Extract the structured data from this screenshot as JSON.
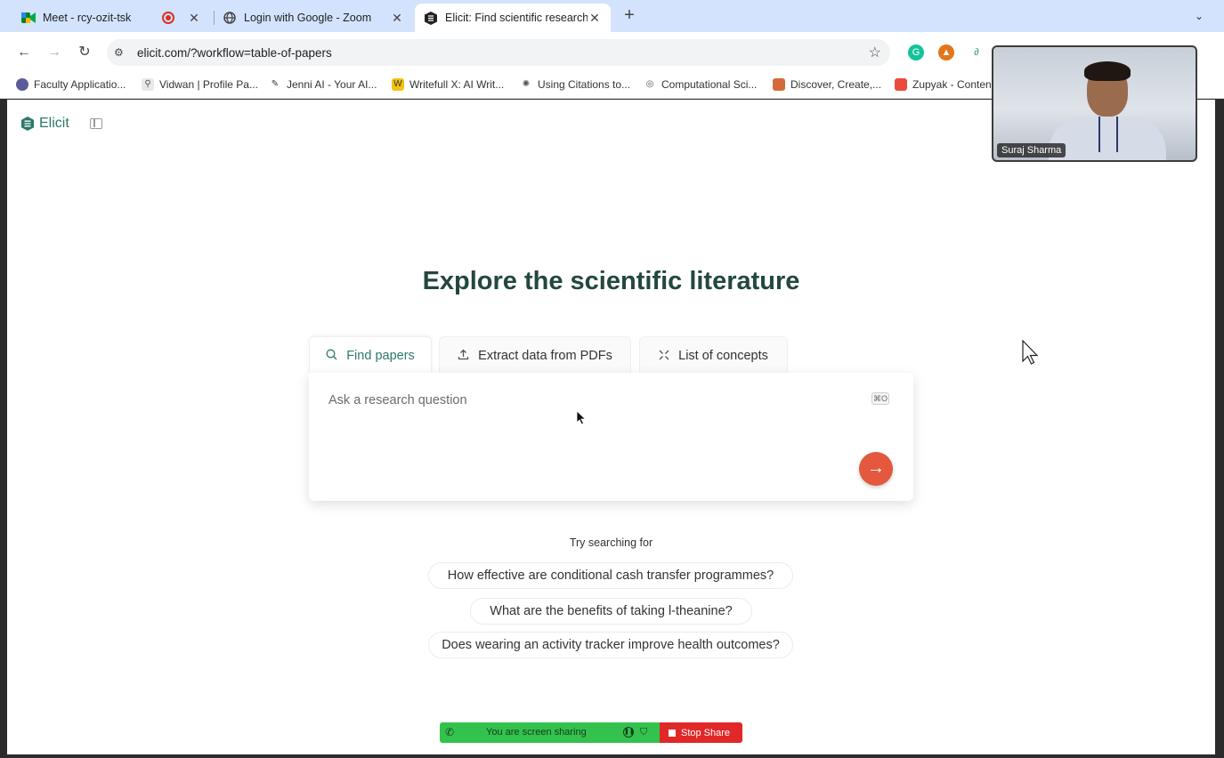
{
  "browser": {
    "tabs": [
      {
        "title": "Meet - rcy-ozit-tsk",
        "icon": "google-meet-icon",
        "recording": true
      },
      {
        "title": "Login with Google - Zoom",
        "icon": "globe-icon"
      },
      {
        "title": "Elicit: Find scientific research",
        "icon": "elicit-icon",
        "active": true
      }
    ],
    "new_tab": "+",
    "url": "elicit.com/?workflow=table-of-papers",
    "bookmarks": [
      "Faculty Applicatio...",
      "Vidwan | Profile Pa...",
      "Jenni AI - Your AI...",
      "Writefull X: AI Writ...",
      "Using Citations to...",
      "Computational Sci...",
      "Discover, Create,...",
      "Zupyak - Conten"
    ]
  },
  "app": {
    "logo": "Elicit",
    "headline": "Explore the scientific literature",
    "workflow_tabs": [
      {
        "label": "Find papers",
        "icon": "search-icon",
        "active": true
      },
      {
        "label": "Extract data from PDFs",
        "icon": "upload-icon"
      },
      {
        "label": "List of concepts",
        "icon": "collapse-icon"
      }
    ],
    "search": {
      "placeholder": "Ask a research question",
      "shortcut": "⌘O"
    },
    "try_label": "Try searching for",
    "suggestions": [
      "How effective are conditional cash transfer programmes?",
      "What are the benefits of taking l-theanine?",
      "Does wearing an activity tracker improve health outcomes?"
    ],
    "accent_color": "#2b7a6c",
    "submit_color": "#e4583e"
  },
  "video": {
    "participant_name": "Suraj Sharma"
  },
  "screen_share": {
    "status": "You are screen sharing",
    "stop_label": "Stop Share"
  }
}
